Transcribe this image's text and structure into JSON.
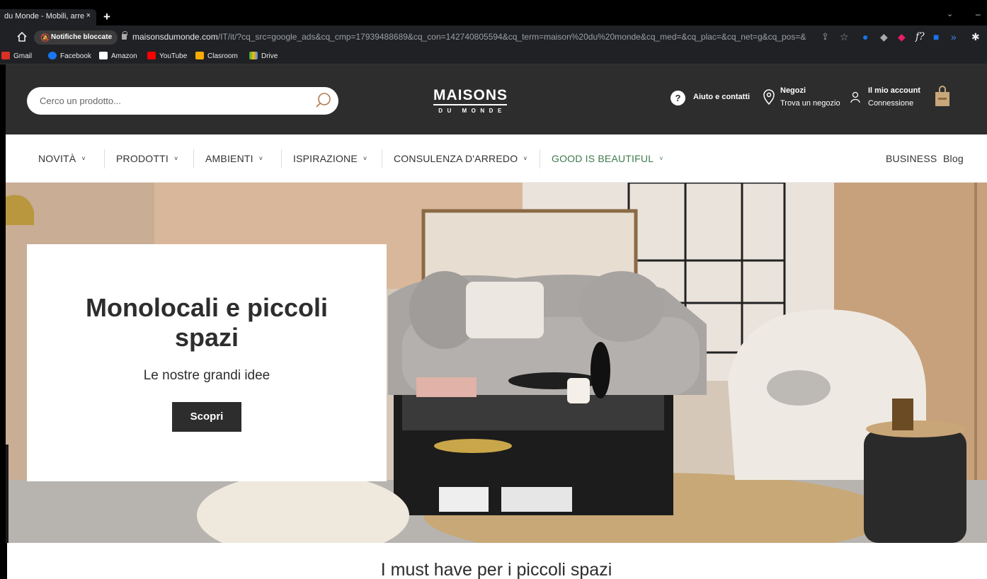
{
  "browser": {
    "tab_title": "du Monde - Mobili, arre",
    "tab_close": "×",
    "new_tab": "+",
    "window_chevron": "⌄",
    "window_minimize": "–",
    "notifications_pill": "Notifiche bloccate",
    "url_host": "maisonsdumonde.com",
    "url_path": "/IT/it/?cq_src=google_ads&cq_cmp=17939488689&cq_con=142740805594&cq_term=maison%20du%20monde&cq_med=&cq_plac=&cq_net=g&cq_pos=&cq_plt=gp&...",
    "extension_f": "f?",
    "bookmarks": [
      {
        "label": "Gmail",
        "color": "#d93025"
      },
      {
        "label": "Facebook",
        "color": "#1877f2"
      },
      {
        "label": "Amazon",
        "color": "#ffffff"
      },
      {
        "label": "YouTube",
        "color": "#ff0000"
      },
      {
        "label": "Clasroom",
        "color": "#f9ab00"
      },
      {
        "label": "Drive",
        "color": "#34a853"
      }
    ]
  },
  "header": {
    "search_placeholder": "Cerco un prodotto...",
    "logo_top": "MAISONS",
    "logo_bottom": "DU MONDE",
    "help_icon_glyph": "?",
    "help": "Aiuto e contatti",
    "stores_title": "Negozi",
    "stores_sub": "Trova un negozio",
    "account_title": "Il mio account",
    "account_sub": "Connessione"
  },
  "nav": {
    "items": [
      {
        "label": "NOVITÀ"
      },
      {
        "label": "PRODOTTI"
      },
      {
        "label": "AMBIENTI"
      },
      {
        "label": "ISPIRAZIONE"
      },
      {
        "label": "CONSULENZA D'ARREDO"
      },
      {
        "label": "GOOD IS BEAUTIFUL"
      }
    ],
    "chevron": "˅",
    "business": "BUSINESS",
    "blog": "Blog"
  },
  "hero": {
    "title": "Monolocali e piccoli spazi",
    "subtitle": "Le nostre grandi idee",
    "button": "Scopri"
  },
  "section": {
    "title": "I must have per i piccoli spazi"
  },
  "colors": {
    "header_bg": "#2d2d2d",
    "green_nav": "#3e7a4d",
    "button_bg": "#2d2d2d"
  }
}
